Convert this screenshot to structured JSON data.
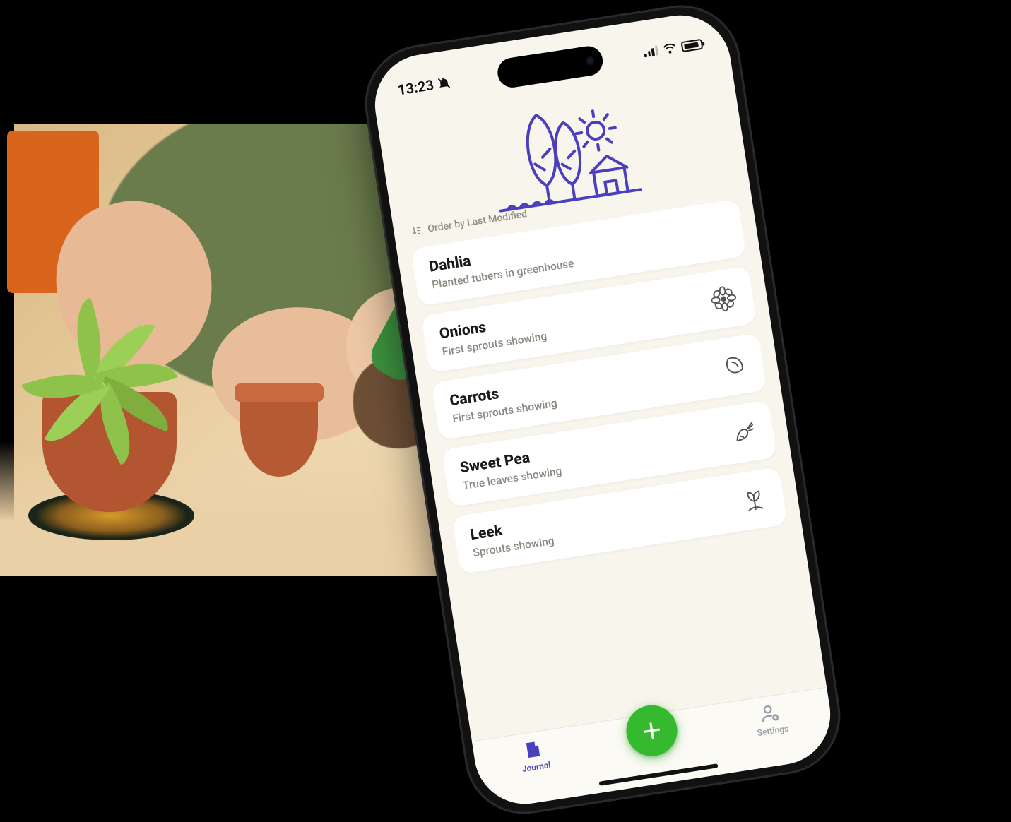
{
  "status_bar": {
    "time": "13:23",
    "silent": true
  },
  "app": {
    "sort_label": "Order by Last Modified"
  },
  "journal": [
    {
      "name": "Dahlia",
      "note": "Planted tubers in greenhouse",
      "icon": "none"
    },
    {
      "name": "Onions",
      "note": "First sprouts showing",
      "icon": "flower"
    },
    {
      "name": "Carrots",
      "note": "First sprouts showing",
      "icon": "seed"
    },
    {
      "name": "Sweet Pea",
      "note": "True leaves showing",
      "icon": "carrot"
    },
    {
      "name": "Leek",
      "note": "Sprouts showing",
      "icon": "sprout"
    }
  ],
  "tabs": {
    "journal": "Journal",
    "settings": "Settings"
  },
  "colors": {
    "accent": "#4a3fbf",
    "fab": "#35b92e",
    "screen_bg": "#f7f5ec",
    "card_bg": "#ffffff"
  }
}
